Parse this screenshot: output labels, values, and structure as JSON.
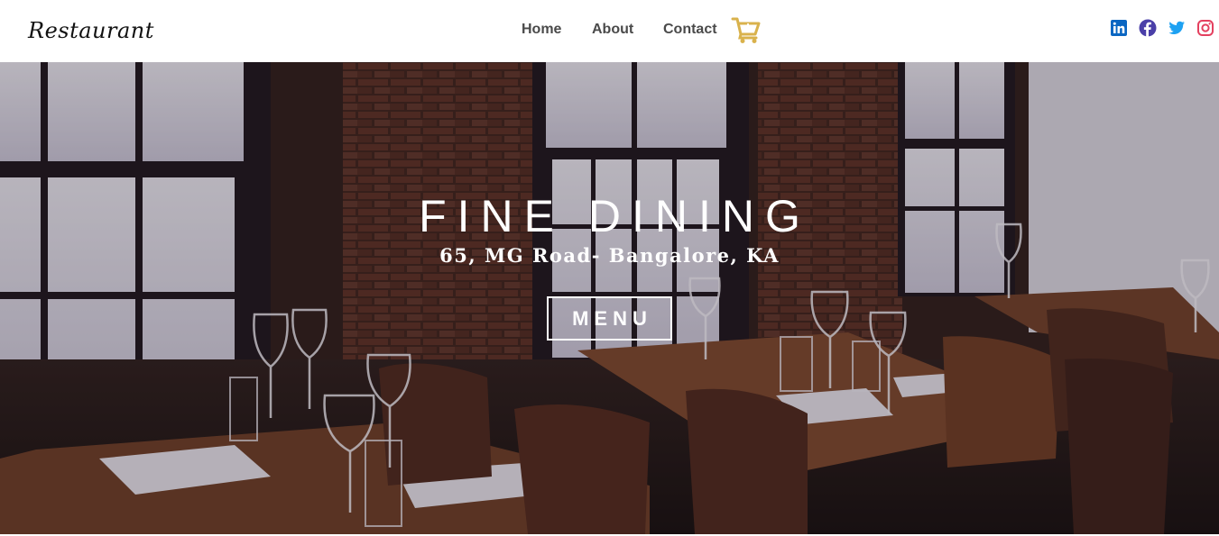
{
  "navbar": {
    "brand": "Restaurant",
    "links": [
      {
        "label": "Home"
      },
      {
        "label": "About"
      },
      {
        "label": "Contact"
      }
    ],
    "cart_icon": "cart-arrow-down-icon",
    "accent_color": "#d9b24c"
  },
  "socials": [
    {
      "icon": "linkedin-icon",
      "color": "#0a66c2"
    },
    {
      "icon": "facebook-icon",
      "color": "#4a3fa8"
    },
    {
      "icon": "twitter-icon",
      "color": "#1da1f2"
    },
    {
      "icon": "instagram-icon",
      "color": "#e4405f"
    }
  ],
  "hero": {
    "title": "FINE DINING",
    "address": "65, MG Road- Bangalore, KA",
    "menu_button": "MENU"
  }
}
